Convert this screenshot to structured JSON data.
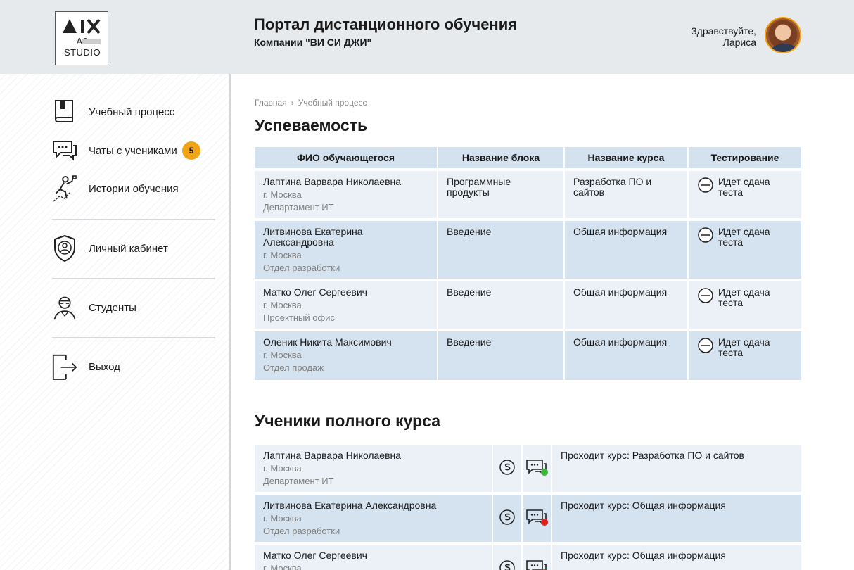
{
  "header": {
    "logo_line1": "A9",
    "logo_line2": "STUDIO",
    "title": "Портал дистанционного обучения",
    "subtitle": "Компании \"ВИ СИ ДЖИ\"",
    "greeting_line1": "Здравствуйте,",
    "greeting_line2": "Лариса"
  },
  "sidebar": {
    "items": [
      {
        "label": "Учебный процесс",
        "icon": "book-icon"
      },
      {
        "label": "Чаты с учениками",
        "icon": "chat-bubbles-icon",
        "badge": "5"
      },
      {
        "label": "Истории обучения",
        "icon": "climbing-person-icon"
      },
      {
        "label": "Личный кабинет",
        "icon": "shield-user-icon"
      },
      {
        "label": "Студенты",
        "icon": "student-icon"
      },
      {
        "label": "Выход",
        "icon": "exit-icon"
      }
    ]
  },
  "breadcrumb": {
    "home": "Главная",
    "current": "Учебный процесс"
  },
  "grades": {
    "title": "Успеваемость",
    "columns": [
      "ФИО обучающегося",
      "Название блока",
      "Название курса",
      "Тестирование"
    ],
    "rows": [
      {
        "name": "Лаптина Варвара Николаевна",
        "city": "г. Москва",
        "dept": "Департамент ИТ",
        "block": "Программные продукты",
        "course": "Разработка ПО и сайтов",
        "test": "Идет сдача теста"
      },
      {
        "name": "Литвинова Екатерина Александровна",
        "city": "г. Москва",
        "dept": "Отдел разработки",
        "block": "Введение",
        "course": "Общая информация",
        "test": "Идет сдача теста"
      },
      {
        "name": "Матко Олег Сергеевич",
        "city": "г. Москва",
        "dept": "Проектный офис",
        "block": "Введение",
        "course": "Общая информация",
        "test": "Идет сдача теста"
      },
      {
        "name": "Оленик Никита Максимович",
        "city": "г. Москва",
        "dept": "Отдел продаж",
        "block": "Введение",
        "course": "Общая информация",
        "test": "Идет сдача теста"
      }
    ]
  },
  "students": {
    "title": "Ученики полного курса",
    "rows": [
      {
        "name": "Лаптина Варвара Николаевна",
        "city": "г. Москва",
        "dept": "Департамент ИТ",
        "status": "Проходит курс: Разработка ПО и сайтов",
        "chat_status_color": "#3cb43c"
      },
      {
        "name": "Литвинова Екатерина Александровна",
        "city": "г. Москва",
        "dept": "Отдел разработки",
        "status": "Проходит курс: Общая информация",
        "chat_status_color": "#e02020"
      },
      {
        "name": "Матко Олег Сергеевич",
        "city": "г. Москва",
        "dept": "",
        "status": "Проходит курс: Общая информация",
        "chat_status_color": "#e02020"
      }
    ]
  },
  "colors": {
    "accent": "#f2a417",
    "header_bg": "#e7eaed",
    "table_head": "#d4e2f0",
    "row_light": "#ebf1f7",
    "row_dark": "#d5e2ef"
  }
}
